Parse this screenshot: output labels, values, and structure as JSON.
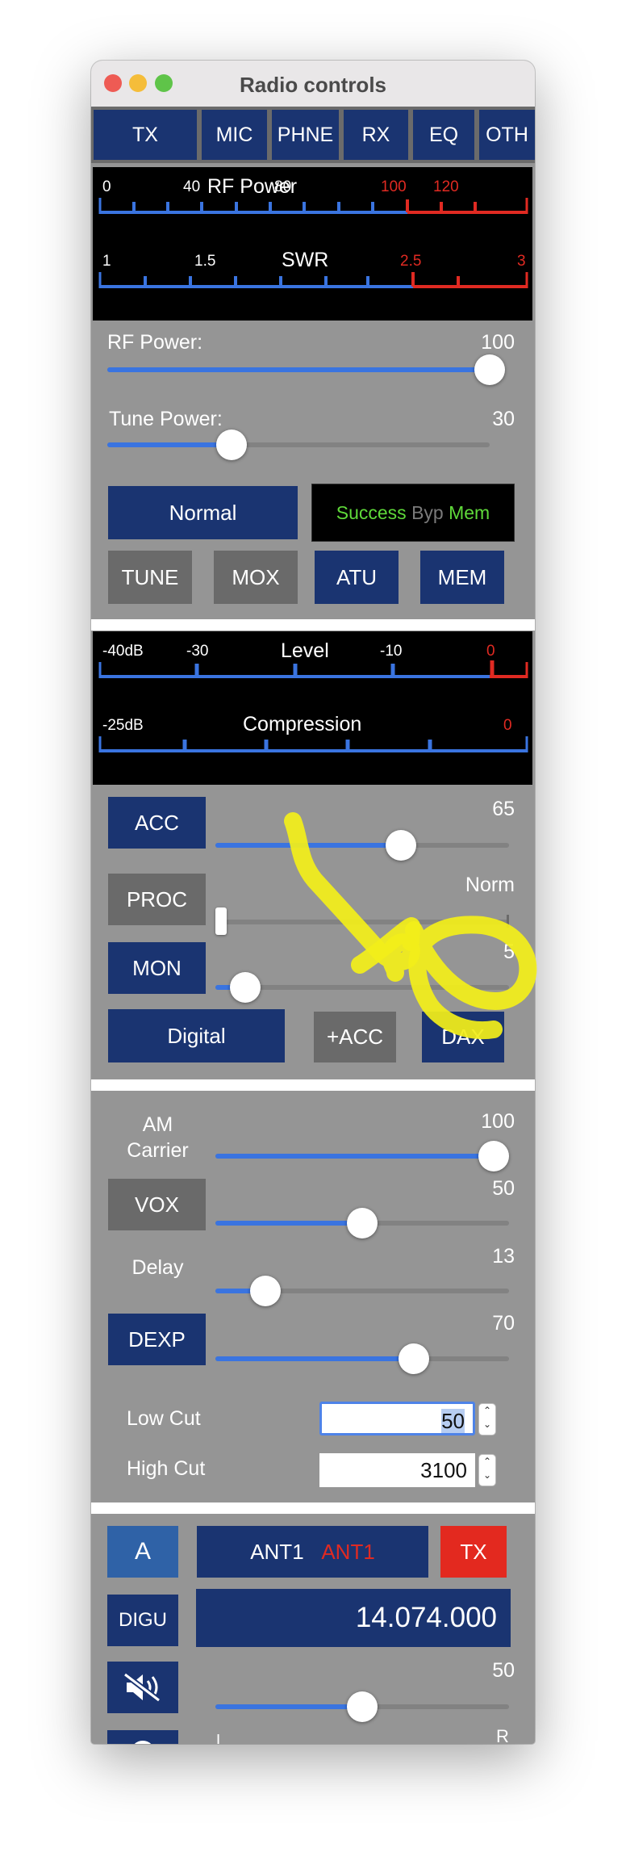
{
  "window": {
    "title": "Radio controls"
  },
  "tabs": [
    "TX",
    "MIC",
    "PHNE",
    "RX",
    "EQ",
    "OTH"
  ],
  "power_meter": {
    "title": "RF Power",
    "ticks": [
      "0",
      "40",
      "80",
      "100",
      "120"
    ],
    "swr_title": "SWR",
    "swr_ticks": [
      "1",
      "1.5",
      "2.5",
      "3"
    ]
  },
  "rf_power": {
    "label": "RF Power:",
    "value": "100",
    "level": 1.0
  },
  "tune_power": {
    "label": "Tune Power:",
    "value": "30",
    "level": 0.3
  },
  "normal_button": "Normal",
  "status": {
    "success": "Success",
    "byp": "Byp",
    "mem": "Mem"
  },
  "tx_buttons": [
    "TUNE",
    "MOX",
    "ATU",
    "MEM"
  ],
  "level_meter": {
    "title": "Level",
    "ticks": [
      "-40dB",
      "-30",
      "-10",
      "0"
    ],
    "comp_title": "Compression",
    "comp_ticks": [
      "-25dB",
      "0"
    ]
  },
  "acc": {
    "label": "ACC",
    "value": "65",
    "level": 0.65
  },
  "proc": {
    "label": "PROC",
    "value": "Norm",
    "level": 0.0
  },
  "mon": {
    "label": "MON",
    "value": "5",
    "level": 0.1
  },
  "mic_buttons": {
    "digital": "Digital",
    "plus_acc": "+ACC",
    "dax": "DAX"
  },
  "am_carrier": {
    "label": "AM\nCarrier",
    "value": "100",
    "level": 1.0
  },
  "vox": {
    "label": "VOX",
    "value": "50",
    "level": 0.5
  },
  "delay": {
    "label": "Delay",
    "value": "13",
    "level": 0.17
  },
  "dexp": {
    "label": "DEXP",
    "value": "70",
    "level": 0.67
  },
  "low_cut": {
    "label": "Low Cut",
    "value": "50"
  },
  "high_cut": {
    "label": "High Cut",
    "value": "3100"
  },
  "slice": {
    "letter": "A",
    "ant_rx": "ANT1",
    "ant_tx": "ANT1",
    "tx": "TX",
    "mode": "DIGU",
    "frequency": "14.074.000",
    "audio_value": "50",
    "audio_level": 0.5,
    "pan_left": "L",
    "pan_right": "R"
  },
  "colors": {
    "panel": "#959595",
    "button_blue": "#1a3471",
    "button_gray": "#6a6a6a",
    "slider_fill": "#3a74e0",
    "meter_red": "#e02a22",
    "status_green": "#5fd93a",
    "annotation_yellow": "#f2ee1a"
  }
}
